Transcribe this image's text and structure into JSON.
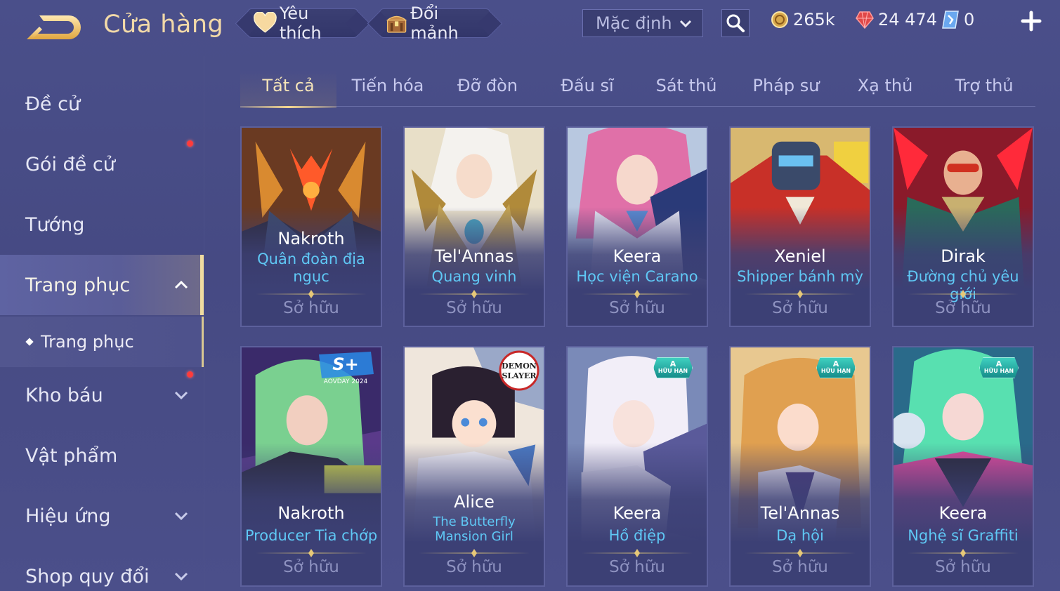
{
  "header": {
    "title": "Cửa hàng",
    "favorites_label": "Yêu thích",
    "shard_exchange_label": "Đổi mảnh",
    "sort": {
      "selected": "Mặc định"
    },
    "currencies": {
      "gold": "265k",
      "ruby": "24 474",
      "voucher": "0"
    }
  },
  "sidebar": {
    "items": [
      {
        "label": "Đề cử"
      },
      {
        "label": "Gói đề cử"
      },
      {
        "label": "Tướng"
      },
      {
        "label": "Trang phục"
      },
      {
        "label": "Trang phục"
      },
      {
        "label": "Kho báu"
      },
      {
        "label": "Vật phẩm"
      },
      {
        "label": "Hiệu ứng"
      },
      {
        "label": "Shop quy đổi"
      }
    ]
  },
  "tabs": [
    {
      "label": "Tất cả"
    },
    {
      "label": "Tiến hóa"
    },
    {
      "label": "Đỡ đòn"
    },
    {
      "label": "Đấu sĩ"
    },
    {
      "label": "Sát thủ"
    },
    {
      "label": "Pháp sư"
    },
    {
      "label": "Xạ thủ"
    },
    {
      "label": "Trợ thủ"
    }
  ],
  "cards": [
    {
      "hero": "Nakroth",
      "skin": "Quân đoàn địa ngục",
      "status": "Sở hữu"
    },
    {
      "hero": "Tel'Annas",
      "skin": "Quang vinh",
      "status": "Sở hữu"
    },
    {
      "hero": "Keera",
      "skin": "Học viện Carano",
      "status": "Sở hữu"
    },
    {
      "hero": "Xeniel",
      "skin": "Shipper bánh mỳ",
      "status": "Sở hữu"
    },
    {
      "hero": "Dirak",
      "skin": "Đường chủ yêu giới",
      "status": "Sở hữu"
    },
    {
      "hero": "Nakroth",
      "skin": "Producer Tia chớp",
      "status": "Sở hữu",
      "event_logo": "S+",
      "event_caption": "AOVDAY 2024"
    },
    {
      "hero": "Alice",
      "skin": "The Butterfly Mansion Girl",
      "status": "Sở hữu",
      "collab_logo_top": "DEMON",
      "collab_logo_bottom": "SLAYER"
    },
    {
      "hero": "Keera",
      "skin": "Hồ điệp",
      "status": "Sở hữu",
      "badge_letter": "A",
      "badge_text": "HỮU HẠN"
    },
    {
      "hero": "Tel'Annas",
      "skin": "Dạ hội",
      "status": "Sở hữu",
      "badge_letter": "A",
      "badge_text": "HỮU HẠN"
    },
    {
      "hero": "Keera",
      "skin": "Nghệ sĩ Graffiti",
      "status": "Sở hữu",
      "badge_letter": "A",
      "badge_text": "HỮU HẠN"
    }
  ],
  "colors": {
    "background": "#4a4f8a",
    "title_gold": "#f2d9a8",
    "skin_name_cyan": "#5fc8f5",
    "owned_gray": "#8e92c0",
    "notification_red": "#ff3b3b",
    "active_accent": "#f5d890"
  },
  "icons": [
    "back-arrow-icon",
    "heart-icon",
    "treasure-chest-icon",
    "chevron-down-icon",
    "search-icon",
    "gold-coin-icon",
    "ruby-gem-icon",
    "voucher-icon",
    "plus-icon",
    "chevron-up-icon",
    "diamond-bullet-icon"
  ]
}
